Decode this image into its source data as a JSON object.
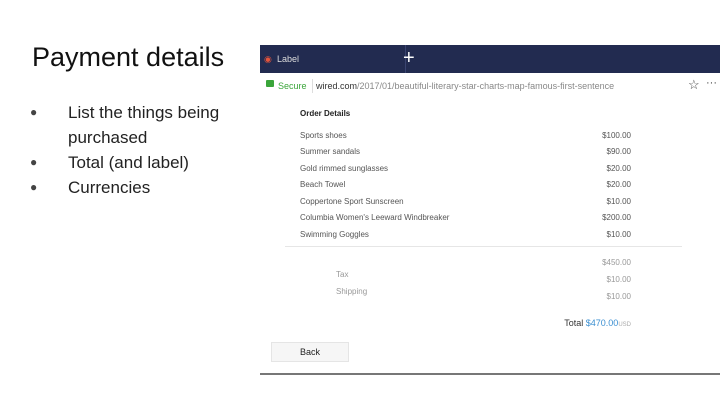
{
  "slide": {
    "title": "Payment details",
    "bullets": [
      "List the things being purchased",
      "Total (and label)",
      "Currencies"
    ]
  },
  "browser": {
    "tab_label": "Label",
    "new_tab": "+",
    "secure": "Secure",
    "url_domain": "wired.com",
    "url_path": "/2017/01/beautiful-literary-star-charts-map-famous-first-sentence",
    "star": "☆",
    "more": "···"
  },
  "order": {
    "heading": "Order Details",
    "items": [
      {
        "name": "Sports shoes",
        "price": "$100.00"
      },
      {
        "name": "Summer sandals",
        "price": "$90.00"
      },
      {
        "name": "Gold rimmed sunglasses",
        "price": "$20.00"
      },
      {
        "name": "Beach Towel",
        "price": "$20.00"
      },
      {
        "name": "Coppertone Sport Sunscreen",
        "price": "$10.00"
      },
      {
        "name": "Columbia Women's Leeward Windbreaker",
        "price": "$200.00"
      },
      {
        "name": "Swimming Goggles",
        "price": "$10.00"
      }
    ],
    "subtotal": "$450.00",
    "tax_label": "Tax",
    "tax": "$10.00",
    "shipping_label": "Shipping",
    "shipping": "$10.00",
    "total_label": "Total",
    "total": "$470.00",
    "currency": "USD",
    "back": "Back"
  }
}
